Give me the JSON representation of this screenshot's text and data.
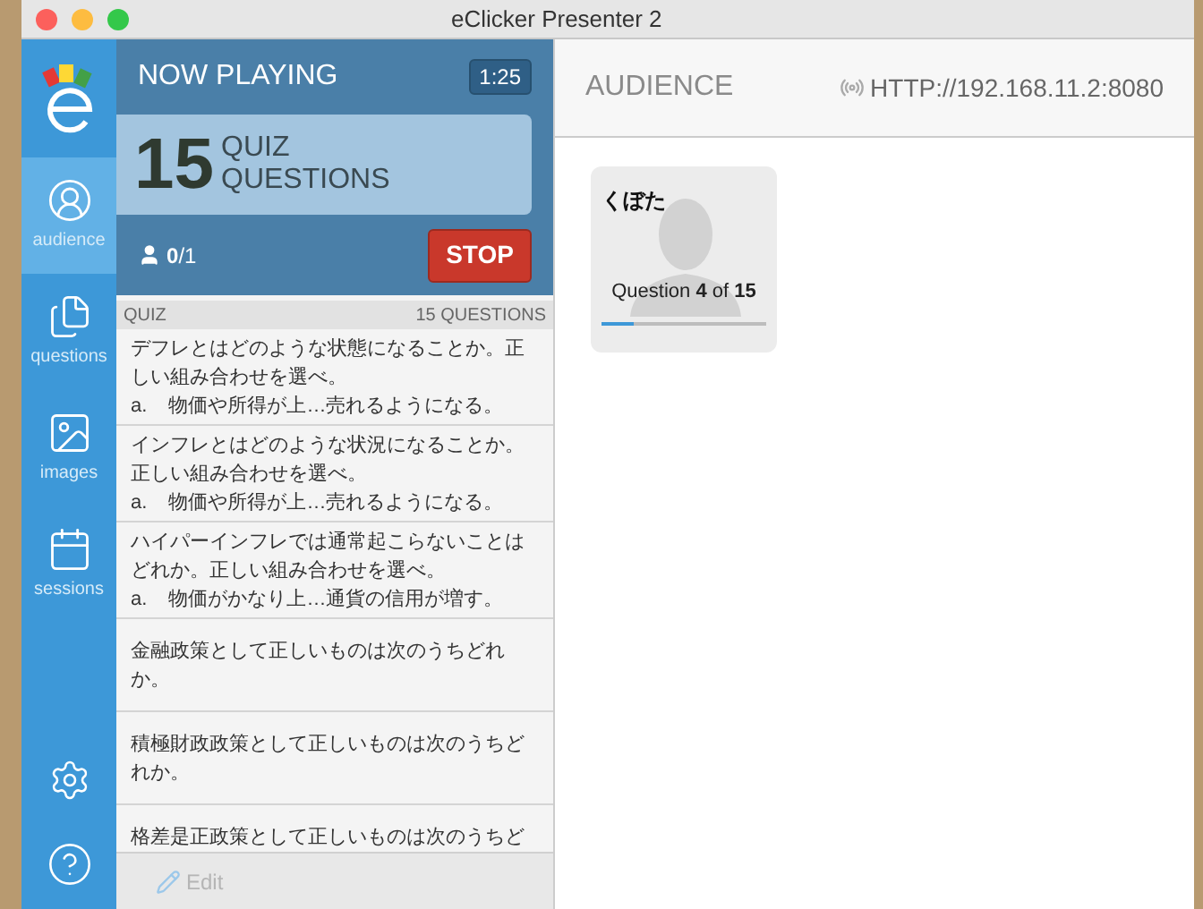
{
  "window": {
    "title": "eClicker Presenter 2"
  },
  "sidebar": {
    "items": [
      {
        "kind": "audience",
        "label": "audience",
        "selected": true
      },
      {
        "kind": "questions",
        "label": "questions",
        "selected": false
      },
      {
        "kind": "images",
        "label": "images",
        "selected": false
      },
      {
        "kind": "sessions",
        "label": "sessions",
        "selected": false
      }
    ]
  },
  "now_playing": {
    "title": "NOW PLAYING",
    "timer": "1:25",
    "count": "15",
    "type": "QUIZ",
    "unit": "QUESTIONS",
    "respondents": "**0**/1",
    "stop_button": "STOP"
  },
  "quiz": {
    "title": "QUIZ",
    "count": "15 QUESTIONS",
    "items": [
      {
        "question": "デフレとはどのような状態になることか。正しい組み合わせを選べ。",
        "answer_label": "a.",
        "answer": "物価や所得が上…売れるようになる。"
      },
      {
        "question": "インフレとはどのような状況になることか。正しい組み合わせを選べ。",
        "answer_label": "a.",
        "answer": "物価や所得が上…売れるようになる。"
      },
      {
        "question": "ハイパーインフレでは通常起こらないことはどれか。正しい組み合わせを選べ。",
        "answer_label": "a.",
        "answer": "物価がかなり上…通貨の信用が増す。"
      },
      {
        "question": "金融政策として正しいものは次のうちどれか。"
      },
      {
        "question": "積極財政政策として正しいものは次のうちどれか。"
      },
      {
        "question": "格差是正政策として正しいものは次のうちど"
      }
    ],
    "edit_button": "Edit"
  },
  "audience": {
    "title": "AUDIENCE",
    "url": "HTTP://192.168.11.2:8080",
    "students": [
      {
        "name": "くぼた",
        "progress": "Question **4** of **15**",
        "level": 0.2
      }
    ]
  }
}
